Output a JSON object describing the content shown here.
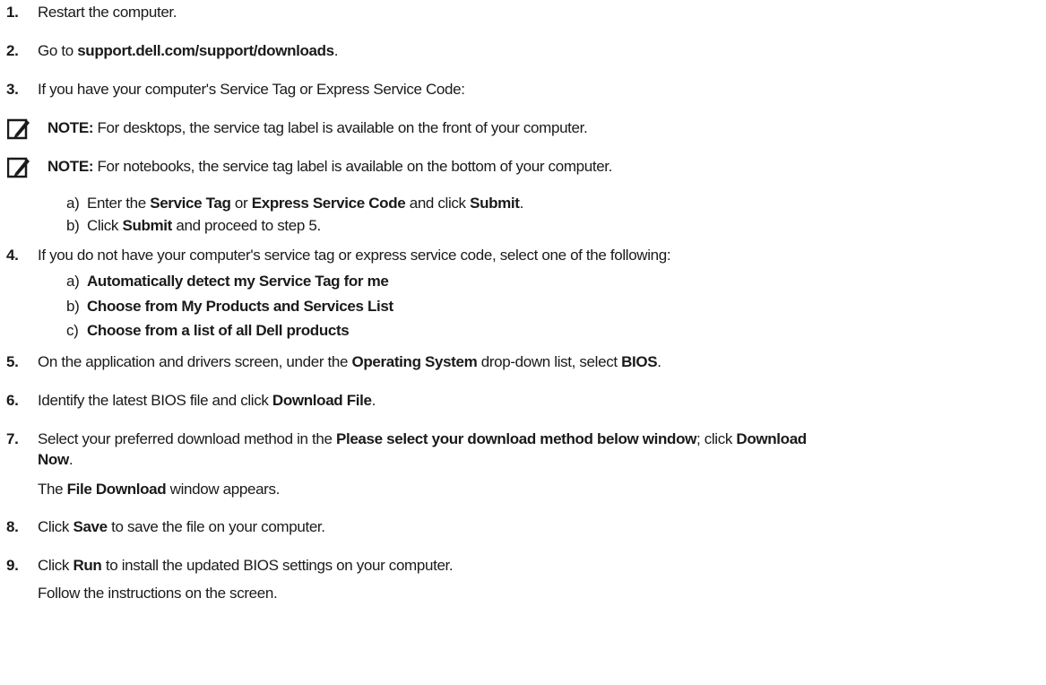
{
  "steps": [
    {
      "num": "1.",
      "parts": [
        "Restart the computer."
      ]
    },
    {
      "num": "2.",
      "parts": [
        "Go to ",
        "support.dell.com/support/downloads",
        "."
      ]
    },
    {
      "num": "3.",
      "parts": [
        "If you have your computer's Service Tag or Express Service Code:"
      ]
    },
    {
      "num": "4.",
      "parts": [
        "If you do not have your computer's service tag or express service code, select one of the following:"
      ]
    },
    {
      "num": "5.",
      "parts": [
        "On the application and drivers screen, under the ",
        "Operating System",
        " drop-down list, select ",
        "BIOS",
        "."
      ]
    },
    {
      "num": "6.",
      "parts": [
        "Identify the latest BIOS file and click ",
        "Download File",
        "."
      ]
    },
    {
      "num": "7.",
      "parts": [
        "Select your preferred download method in the ",
        "Please select your download method below window",
        "; click ",
        "Download"
      ],
      "continuation": [
        "Now",
        "."
      ]
    },
    {
      "num": "8.",
      "parts": [
        "Click ",
        "Save",
        " to save the file on your computer."
      ]
    },
    {
      "num": "9.",
      "parts": [
        "Click ",
        "Run",
        " to install the updated BIOS settings on your computer."
      ]
    }
  ],
  "notes": [
    {
      "label": "NOTE:",
      "text": " For desktops, the service tag label is available on the front of your computer.",
      "icon": "pencil-note-icon"
    },
    {
      "label": "NOTE:",
      "text": " For notebooks, the service tag label is available on the bottom of your computer.",
      "icon": "pencil-note-icon"
    }
  ],
  "substeps_3": [
    {
      "letter": "a)",
      "parts": [
        "Enter the ",
        "Service Tag",
        " or ",
        "Express Service Code",
        " and click ",
        "Submit",
        "."
      ]
    },
    {
      "letter": "b)",
      "parts": [
        "Click ",
        "Submit",
        " and proceed to step 5."
      ]
    }
  ],
  "substeps_4": [
    {
      "letter": "a)",
      "parts": [
        "Automatically detect my Service Tag for me"
      ]
    },
    {
      "letter": "b)",
      "parts": [
        "Choose from My Products and Services List"
      ]
    },
    {
      "letter": "c)",
      "parts": [
        "Choose from a list of all Dell products"
      ]
    }
  ],
  "results": {
    "step7": [
      "The ",
      "File Download",
      " window appears."
    ],
    "step9": "Follow the instructions on the screen."
  }
}
